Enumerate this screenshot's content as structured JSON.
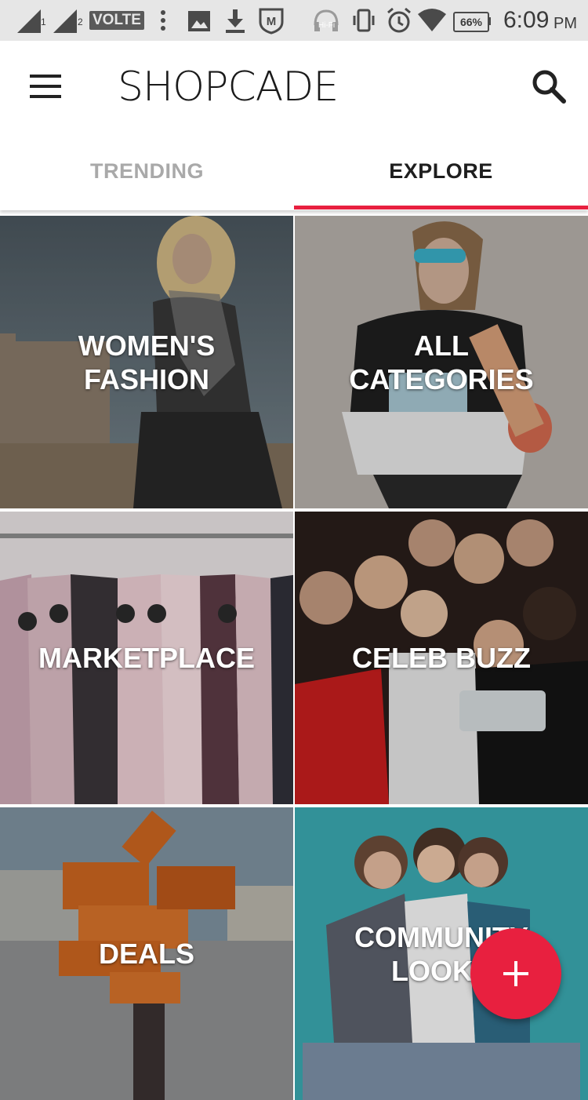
{
  "status_bar": {
    "sim1": "1",
    "sim2": "2",
    "volte": "VOLTE",
    "hifi": "Hi-Fi",
    "battery": "66%",
    "time": "6:09",
    "ampm": "PM",
    "icons": [
      "signal-sim1-icon",
      "signal-sim2-icon",
      "volte-icon",
      "more-dots-icon",
      "image-icon",
      "download-icon",
      "mcafee-icon",
      "headphones-hifi-icon",
      "vibrate-icon",
      "alarm-icon",
      "wifi-icon",
      "battery-icon"
    ]
  },
  "app_bar": {
    "title": "SHOPCADE",
    "menu_icon": "hamburger-menu-icon",
    "search_icon": "search-icon"
  },
  "tabs": [
    {
      "label": "TRENDING",
      "selected": false
    },
    {
      "label": "EXPLORE",
      "selected": true
    }
  ],
  "colors": {
    "accent": "#e8203f",
    "tab_active": "#1e1e1e",
    "tab_inactive": "#a9a9a9",
    "status_bar_bg": "#e6e6e6"
  },
  "tiles": [
    {
      "label": "WOMEN'S\nFASHION"
    },
    {
      "label": "ALL\nCATEGORIES"
    },
    {
      "label": "MARKETPLACE"
    },
    {
      "label": "CELEB BUZZ"
    },
    {
      "label": "DEALS"
    },
    {
      "label": "COMMUNITY\nLOOKS"
    }
  ],
  "fab": {
    "icon": "plus-icon"
  }
}
